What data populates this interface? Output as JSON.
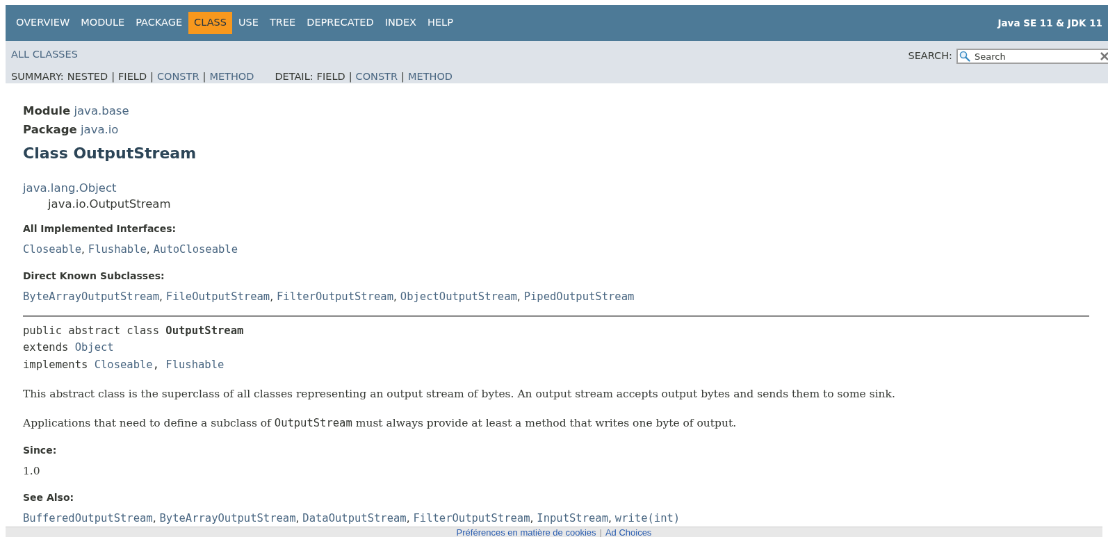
{
  "nav": {
    "items": [
      {
        "label": "OVERVIEW",
        "selected": false
      },
      {
        "label": "MODULE",
        "selected": false
      },
      {
        "label": "PACKAGE",
        "selected": false
      },
      {
        "label": "CLASS",
        "selected": true
      },
      {
        "label": "USE",
        "selected": false
      },
      {
        "label": "TREE",
        "selected": false
      },
      {
        "label": "DEPRECATED",
        "selected": false
      },
      {
        "label": "INDEX",
        "selected": false
      },
      {
        "label": "HELP",
        "selected": false
      }
    ],
    "brand": "Java SE 11 & JDK 11"
  },
  "subnav": {
    "all_classes": "ALL CLASSES",
    "summary": {
      "label": "SUMMARY:",
      "separator": "|",
      "items": [
        {
          "text": "NESTED",
          "kind": "plain"
        },
        {
          "text": "FIELD",
          "kind": "plain"
        },
        {
          "text": "CONSTR",
          "kind": "link"
        },
        {
          "text": "METHOD",
          "kind": "link"
        }
      ]
    },
    "detail": {
      "label": "DETAIL:",
      "separator": "|",
      "items": [
        {
          "text": "FIELD",
          "kind": "plain"
        },
        {
          "text": "CONSTR",
          "kind": "link"
        },
        {
          "text": "METHOD",
          "kind": "link"
        }
      ]
    },
    "search": {
      "label": "SEARCH:",
      "placeholder": "Search"
    }
  },
  "header": {
    "module_label": "Module",
    "module": "java.base",
    "package_label": "Package",
    "package": "java.io",
    "title": "Class OutputStream"
  },
  "inheritance": [
    "java.lang.Object",
    "java.io.OutputStream"
  ],
  "implemented_interfaces": {
    "heading": "All Implemented Interfaces:",
    "separator": ", ",
    "items": [
      "Closeable",
      "Flushable",
      "AutoCloseable"
    ]
  },
  "known_subclasses": {
    "heading": "Direct Known Subclasses:",
    "separator": ", ",
    "items": [
      "ByteArrayOutputStream",
      "FileOutputStream",
      "FilterOutputStream",
      "ObjectOutputStream",
      "PipedOutputStream"
    ]
  },
  "signature": {
    "line1": "public abstract class ",
    "name": "OutputStream",
    "extends_kw": "extends ",
    "extends": "Object",
    "implements_kw": "implements ",
    "implements": [
      "Closeable",
      "Flushable"
    ],
    "separator": ", "
  },
  "description": [
    [
      {
        "kind": "text",
        "text": "This abstract class is the superclass of all classes representing an output stream of bytes. An output stream accepts output bytes and sends them to some sink."
      }
    ],
    [
      {
        "kind": "text",
        "text": "Applications that need to define a subclass of "
      },
      {
        "kind": "code",
        "text": "OutputStream"
      },
      {
        "kind": "text",
        "text": " must always provide at least a method that writes one byte of output."
      }
    ]
  ],
  "since": {
    "heading": "Since:",
    "value": "1.0"
  },
  "see_also": {
    "heading": "See Also:",
    "separator": ", ",
    "items": [
      "BufferedOutputStream",
      "ByteArrayOutputStream",
      "DataOutputStream",
      "FilterOutputStream",
      "InputStream",
      "write(int)"
    ]
  },
  "footer": {
    "links": [
      "Préférences en matière de cookies",
      "Ad Choices"
    ],
    "separator": "|"
  }
}
